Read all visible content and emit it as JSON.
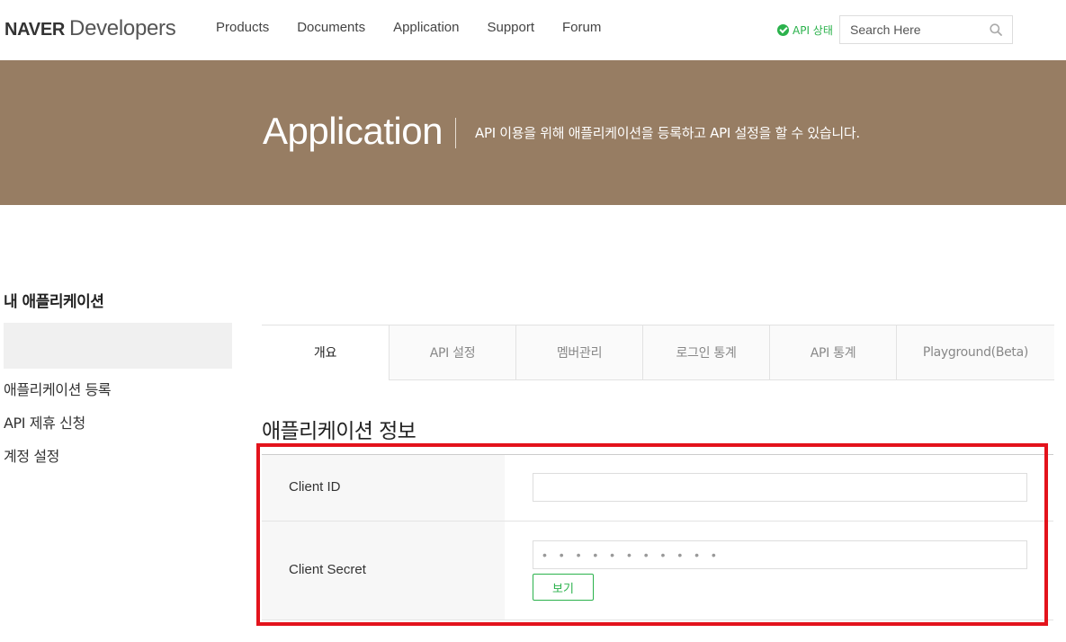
{
  "header": {
    "logo_bold": "NAVER",
    "logo_light": "Developers",
    "nav": [
      "Products",
      "Documents",
      "Application",
      "Support",
      "Forum"
    ],
    "api_status": "API 상태",
    "search_placeholder": "Search Here"
  },
  "banner": {
    "title": "Application",
    "description": "API 이용을 위해 애플리케이션을 등록하고 API 설정을 할 수 있습니다."
  },
  "sidebar": {
    "title": "내 애플리케이션",
    "items": [
      "애플리케이션 등록",
      "API 제휴 신청",
      "계정 설정"
    ]
  },
  "tabs": [
    "개요",
    "API 설정",
    "멤버관리",
    "로그인 통계",
    "API 통계",
    "Playground(Beta)"
  ],
  "active_tab": "개요",
  "section": {
    "title": "애플리케이션 정보",
    "client_id_label": "Client ID",
    "client_id_value": "",
    "client_secret_label": "Client Secret",
    "client_secret_value": "• • • • • • • • • • •",
    "show_button": "보기"
  },
  "colors": {
    "banner_bg": "#977d63",
    "naver_green": "#2bb24c",
    "highlight_red": "#e3131c"
  }
}
